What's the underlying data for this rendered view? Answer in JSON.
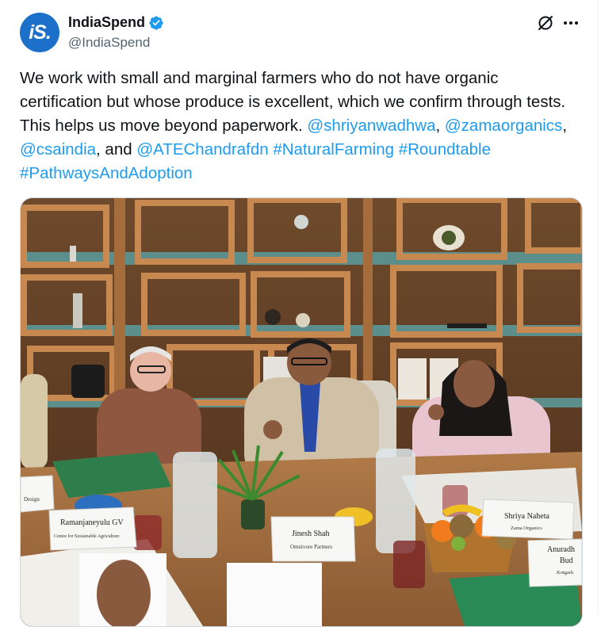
{
  "author": {
    "avatar_text": "iS.",
    "display_name": "IndiaSpend",
    "handle": "@IndiaSpend"
  },
  "post": {
    "text_1": "We work with small and marginal farmers who do not have organic certification but whose produce is excellent, which we confirm through tests. This helps us move beyond paperwork. ",
    "mention_1": "@shriyanwadhwa",
    "sep_1": ", ",
    "mention_2": "@zamaorganics",
    "sep_2": ", ",
    "mention_3": "@csaindia",
    "sep_3": ", and ",
    "mention_4": "@ATEChandrafdn",
    "sep_4": " ",
    "hashtag_1": "#NaturalFarming",
    "sep_5": " ",
    "hashtag_2": "#Roundtable",
    "sep_6": " ",
    "hashtag_3": "#PathwaysAndAdoption"
  },
  "photo": {
    "tag_left": "Design",
    "tag_ramanjaneyulu_name": "Ramanjaneyulu GV",
    "tag_ramanjaneyulu_org": "Centre for Sustainable Agriculture",
    "tag_jinesh_name": "Jinesh Shah",
    "tag_jinesh_org": "Omnivore Partners",
    "tag_shriya_name": "Shriya Naheta",
    "tag_shriya_org": "Zama Organics",
    "tag_anuradha_name": "Anuradh",
    "tag_anuradha_name2": "Bud",
    "tag_anuradha_org": "Kotgarh"
  },
  "icons": {
    "verified": "verified-badge-icon",
    "grok": "grok-icon",
    "more": "more-icon"
  },
  "colors": {
    "link": "#1d9bf0",
    "avatar_bg": "#1d70c9",
    "verified": "#1d9bf0"
  }
}
